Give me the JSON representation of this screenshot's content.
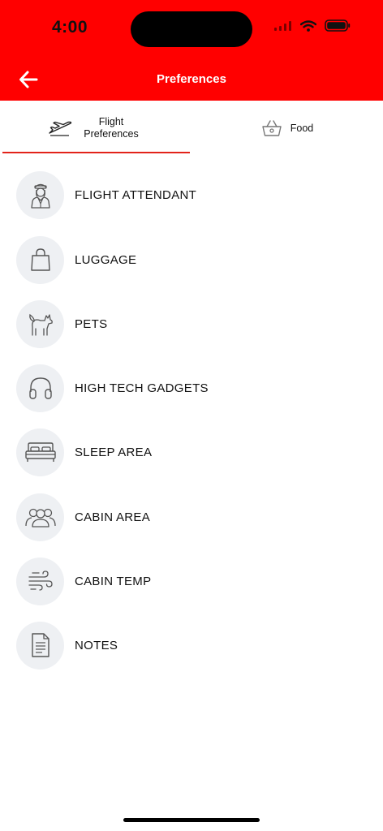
{
  "status": {
    "time": "4:00"
  },
  "header": {
    "title": "Preferences"
  },
  "tabs": [
    {
      "label": "Flight Preferences",
      "icon": "airplane-icon"
    },
    {
      "label": "Food",
      "icon": "basket-icon"
    }
  ],
  "items": [
    {
      "label": "FLIGHT ATTENDANT",
      "icon": "flight-attendant-icon"
    },
    {
      "label": "LUGGAGE",
      "icon": "shopping-bag-icon"
    },
    {
      "label": "PETS",
      "icon": "dog-icon"
    },
    {
      "label": "HIGH TECH GADGETS",
      "icon": "headphones-icon"
    },
    {
      "label": "SLEEP AREA",
      "icon": "bed-icon"
    },
    {
      "label": "CABIN AREA",
      "icon": "people-icon"
    },
    {
      "label": "CABIN TEMP",
      "icon": "wind-icon"
    },
    {
      "label": "NOTES",
      "icon": "document-icon"
    }
  ],
  "colors": {
    "header": "#ff0000",
    "accent": "#e2231a",
    "icon_bg": "#eef0f3"
  }
}
